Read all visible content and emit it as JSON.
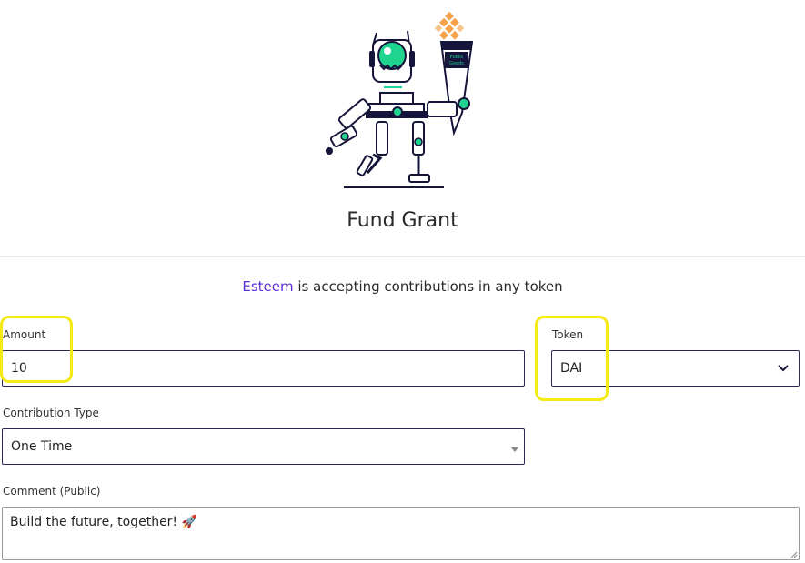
{
  "hero": {
    "title": "Fund Grant",
    "torch_text_line1": "Public",
    "torch_text_line2": "Goods"
  },
  "tagline": {
    "grant_name": "Esteem",
    "rest": " is accepting contributions in any token"
  },
  "form": {
    "amount": {
      "label": "Amount",
      "value": "10"
    },
    "token": {
      "label": "Token",
      "value": "DAI"
    },
    "contribution_type": {
      "label": "Contribution Type",
      "value": "One Time"
    },
    "comment": {
      "label": "Comment (Public)",
      "value": "Build the future, together! 🚀"
    }
  },
  "colors": {
    "accent": "#5b2fd6",
    "robot_green": "#1fd48f",
    "torch_orange": "#f6a34b",
    "highlight": "#f5ea14",
    "ink": "#15143a"
  }
}
